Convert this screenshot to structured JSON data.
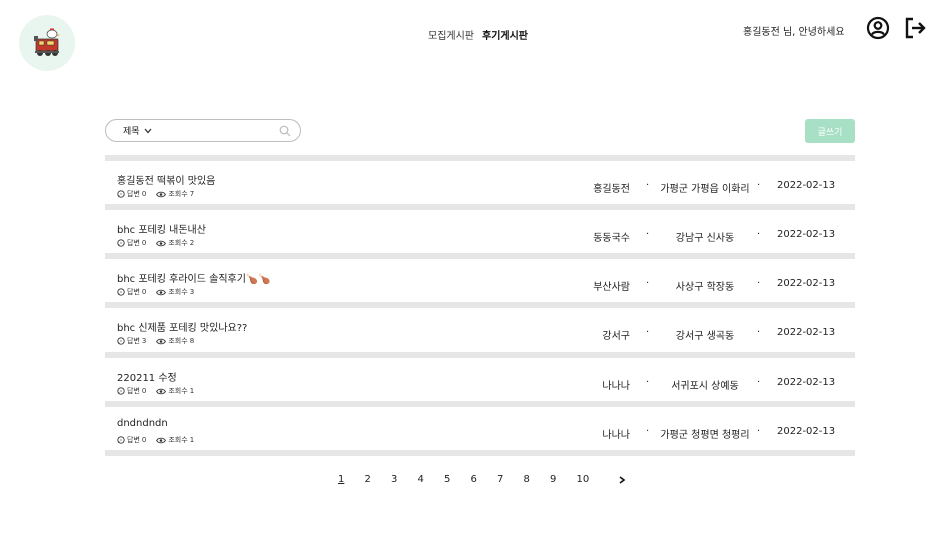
{
  "header": {
    "nav": [
      {
        "label": "모집게시판",
        "active": false
      },
      {
        "label": "후기게시판",
        "active": true
      }
    ],
    "greeting": "홍길동전 님, 안녕하세요"
  },
  "search": {
    "select_value": "제목",
    "placeholder": ""
  },
  "write_button": "글쓰기",
  "labels": {
    "answers": "답변",
    "views": "조회수"
  },
  "posts": [
    {
      "title": "홍길동전 떡볶이 맛있음",
      "answers": "0",
      "views": "7",
      "author": "홍길동전",
      "location": "가평군 가평읍 이화리",
      "date": "2022-02-13"
    },
    {
      "title": "bhc 포테킹 내돈내산",
      "answers": "0",
      "views": "2",
      "author": "동동국수",
      "location": "강남구 신사동",
      "date": "2022-02-13"
    },
    {
      "title": "bhc 포테킹 후라이드 솔직후기🍗🍗",
      "answers": "0",
      "views": "3",
      "author": "부산사람",
      "location": "사상구 학장동",
      "date": "2022-02-13"
    },
    {
      "title": "bhc 신제품 포테킹 맛있나요??",
      "answers": "3",
      "views": "8",
      "author": "강서구",
      "location": "강서구 생곡동",
      "date": "2022-02-13"
    },
    {
      "title": "220211 수정",
      "answers": "0",
      "views": "1",
      "author": "나나나",
      "location": "서귀포시 상예동",
      "date": "2022-02-13"
    },
    {
      "title": "dndndndn",
      "answers": "0",
      "views": "1",
      "author": "나나나",
      "location": "가평군 청평면 청평리",
      "date": "2022-02-13"
    }
  ],
  "pagination": {
    "pages": [
      "1",
      "2",
      "3",
      "4",
      "5",
      "6",
      "7",
      "8",
      "9",
      "10"
    ],
    "current": "1"
  },
  "colors": {
    "accent": "#a8e0c5",
    "divider": "#e6e6e6"
  }
}
